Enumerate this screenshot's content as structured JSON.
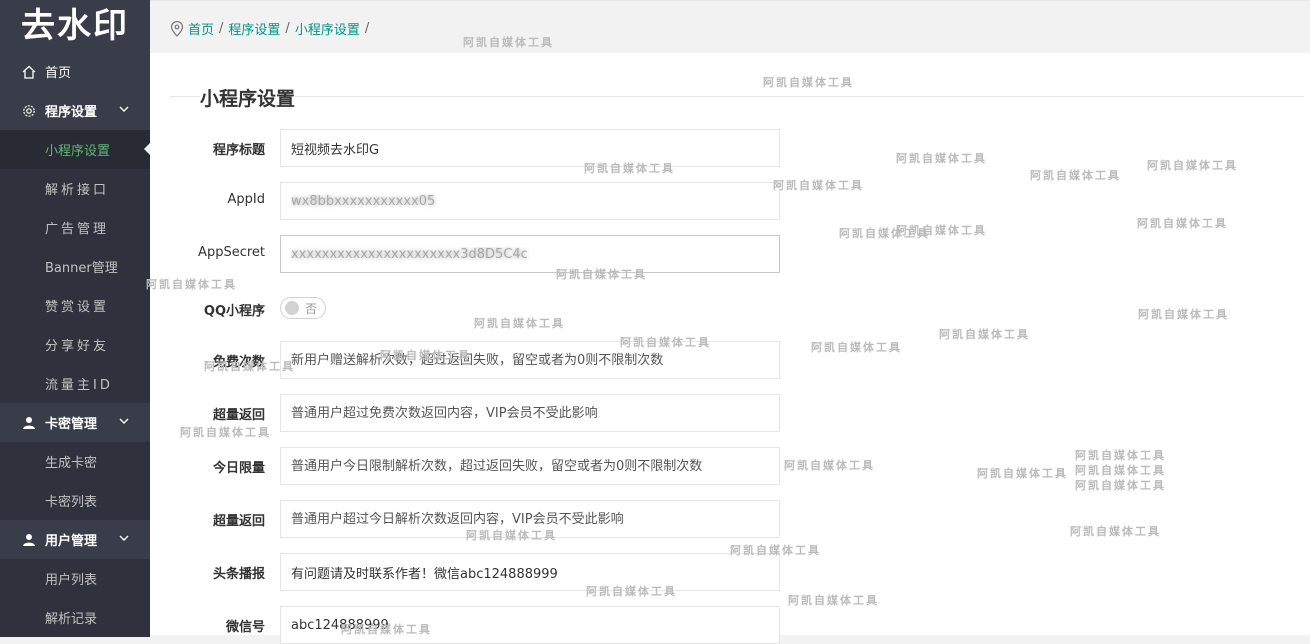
{
  "app": {
    "logo_text": "去水印"
  },
  "sidebar": {
    "home": "首页",
    "groups": [
      {
        "label": "程序设置",
        "items": [
          "小程序设置",
          "解析接口",
          "广告管理",
          "Banner管理",
          "赞赏设置",
          "分享好友",
          "流量主ID"
        ]
      },
      {
        "label": "卡密管理",
        "items": [
          "生成卡密",
          "卡密列表"
        ]
      },
      {
        "label": "用户管理",
        "items": [
          "用户列表",
          "解析记录"
        ]
      }
    ],
    "active_item": "小程序设置"
  },
  "breadcrumb": {
    "items": [
      "首页",
      "程序设置",
      "小程序设置"
    ],
    "separator": "/"
  },
  "page": {
    "title": "小程序设置"
  },
  "form": {
    "title_label": "程序标题",
    "title_value": "短视频去水印G",
    "appid_label": "AppId",
    "appid_value": "wx8bbxxxxxxxxxxx05",
    "appsecret_label": "AppSecret",
    "appsecret_value": "xxxxxxxxxxxxxxxxxxxxxx3d8D5C4c",
    "qq_label": "QQ小程序",
    "qq_switch_text": "否",
    "free_label": "免费次数",
    "free_placeholder": "新用户赠送解析次数，超过返回失败，留空或者为0则不限制次数",
    "over_label": "超量返回",
    "over_placeholder": "普通用户超过免费次数返回内容，VIP会员不受此影响",
    "daily_label": "今日限量",
    "daily_placeholder": "普通用户今日限制解析次数，超过返回失败，留空或者为0则不限制次数",
    "over2_label": "超量返回",
    "over2_placeholder": "普通用户超过今日解析次数返回内容，VIP会员不受此影响",
    "news_label": "头条播报",
    "news_value": "有问题请及时联系作者！微信abc124888999",
    "wechat_label": "微信号",
    "wechat_value": "abc124888999"
  },
  "watermark": {
    "text": "阿凯自媒体工具"
  },
  "colors": {
    "sidebar_bg": "#393d49",
    "accent": "#009688",
    "active_text": "#5fb878"
  }
}
